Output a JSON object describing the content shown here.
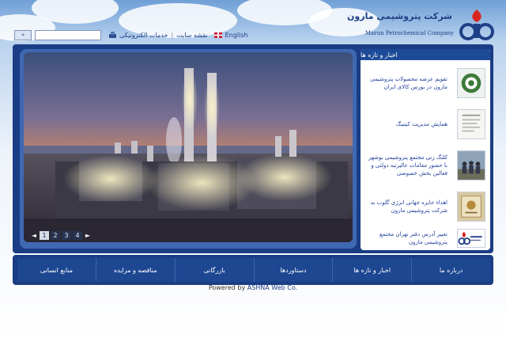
{
  "header": {
    "search": {
      "placeholder": "",
      "button_label": "»"
    },
    "links": {
      "eservices": "خدمات الکترونیکی",
      "sitemap": "نقشه سایت",
      "english": "English"
    },
    "logo": {
      "name_fa": "شرکت پتروشیمی مارون",
      "name_en": "Marun  Petrochemical Company"
    }
  },
  "slider": {
    "pages": [
      "1",
      "2",
      "3",
      "4"
    ],
    "active_page": "1",
    "prev_label": "◄",
    "next_label": "►"
  },
  "news": {
    "title": "اخبار و تازه ها",
    "items": [
      {
        "text": "تقویم عرضه محصولات پتروشیمی مارون در بورس کالای ایران"
      },
      {
        "text": "همایش مدیریت کیتینگ"
      },
      {
        "text": "کلنگ زنی مجتمع پتروشیمی بوشهر با حضور مقامات عالیرتبه دولتی و فعالین بخش خصوصی"
      },
      {
        "text": "اهداء جایزه جهانی انرژی گلوب به شرکت پتروشیمی مارون"
      },
      {
        "text": "تغییر آدرس دفتر تهران مجتمع پتروشیمی مارون"
      }
    ]
  },
  "nav": {
    "items": [
      "درباره ما",
      "اخبار و تازه ها",
      "دستاوردها",
      "بازرگانی",
      "مناقصه و مزایده",
      "منابع انسانی"
    ]
  },
  "footer": {
    "powered_by": "Powered by",
    "brand": "ASHNA Web Co."
  },
  "colors": {
    "frame": "#1a3d85",
    "panel": "#3f68b3",
    "link": "#1b3d86",
    "news_text": "#1f3f9b"
  }
}
